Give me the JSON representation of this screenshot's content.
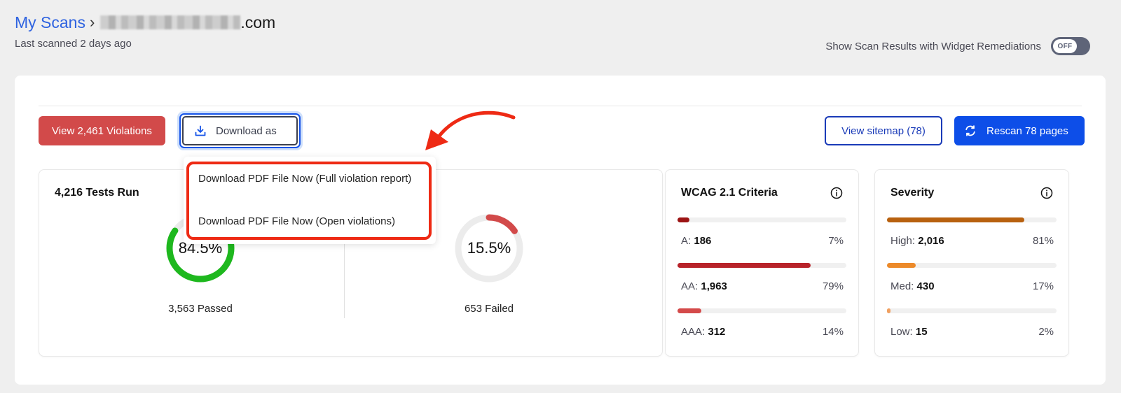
{
  "header": {
    "breadcrumb_root": "My Scans",
    "breadcrumb_separator": "›",
    "domain_suffix": ".com",
    "last_scanned": "Last scanned 2 days ago"
  },
  "widget_toggle": {
    "label": "Show Scan Results with Widget Remediations",
    "state": "OFF"
  },
  "toolbar": {
    "violations_button": "View 2,461 Violations",
    "download_button": "Download as",
    "sitemap_button": "View sitemap (78)",
    "rescan_button": "Rescan 78 pages"
  },
  "download_menu": {
    "items": [
      "Download PDF File Now (Full violation report)",
      "Download PDF File Now (Open violations)"
    ]
  },
  "tests": {
    "title": "4,216 Tests Run",
    "passed": {
      "percent_label": "84.5%",
      "fraction": 0.845,
      "caption": "3,563 Passed",
      "color": "#1eb81e"
    },
    "failed": {
      "percent_label": "15.5%",
      "fraction": 0.155,
      "caption": "653 Failed",
      "color": "#d24a4a"
    }
  },
  "wcag": {
    "title": "WCAG 2.1 Criteria",
    "rows": [
      {
        "label": "A:",
        "value": "186",
        "percent": "7%",
        "fraction": 0.07,
        "color": "#9c1414"
      },
      {
        "label": "AA:",
        "value": "1,963",
        "percent": "79%",
        "fraction": 0.79,
        "color": "#b8232a"
      },
      {
        "label": "AAA:",
        "value": "312",
        "percent": "14%",
        "fraction": 0.14,
        "color": "#d44a4a"
      }
    ]
  },
  "severity": {
    "title": "Severity",
    "rows": [
      {
        "label": "High:",
        "value": "2,016",
        "percent": "81%",
        "fraction": 0.81,
        "color": "#b8610f"
      },
      {
        "label": "Med:",
        "value": "430",
        "percent": "17%",
        "fraction": 0.17,
        "color": "#ec8a2a"
      },
      {
        "label": "Low:",
        "value": "15",
        "percent": "2%",
        "fraction": 0.02,
        "color": "#f0a060"
      }
    ]
  },
  "colors": {
    "accent_blue": "#0d4ee8",
    "link_blue": "#2f63e0",
    "violation_red": "#d24a4a",
    "annotation_red": "#ee2a14"
  }
}
